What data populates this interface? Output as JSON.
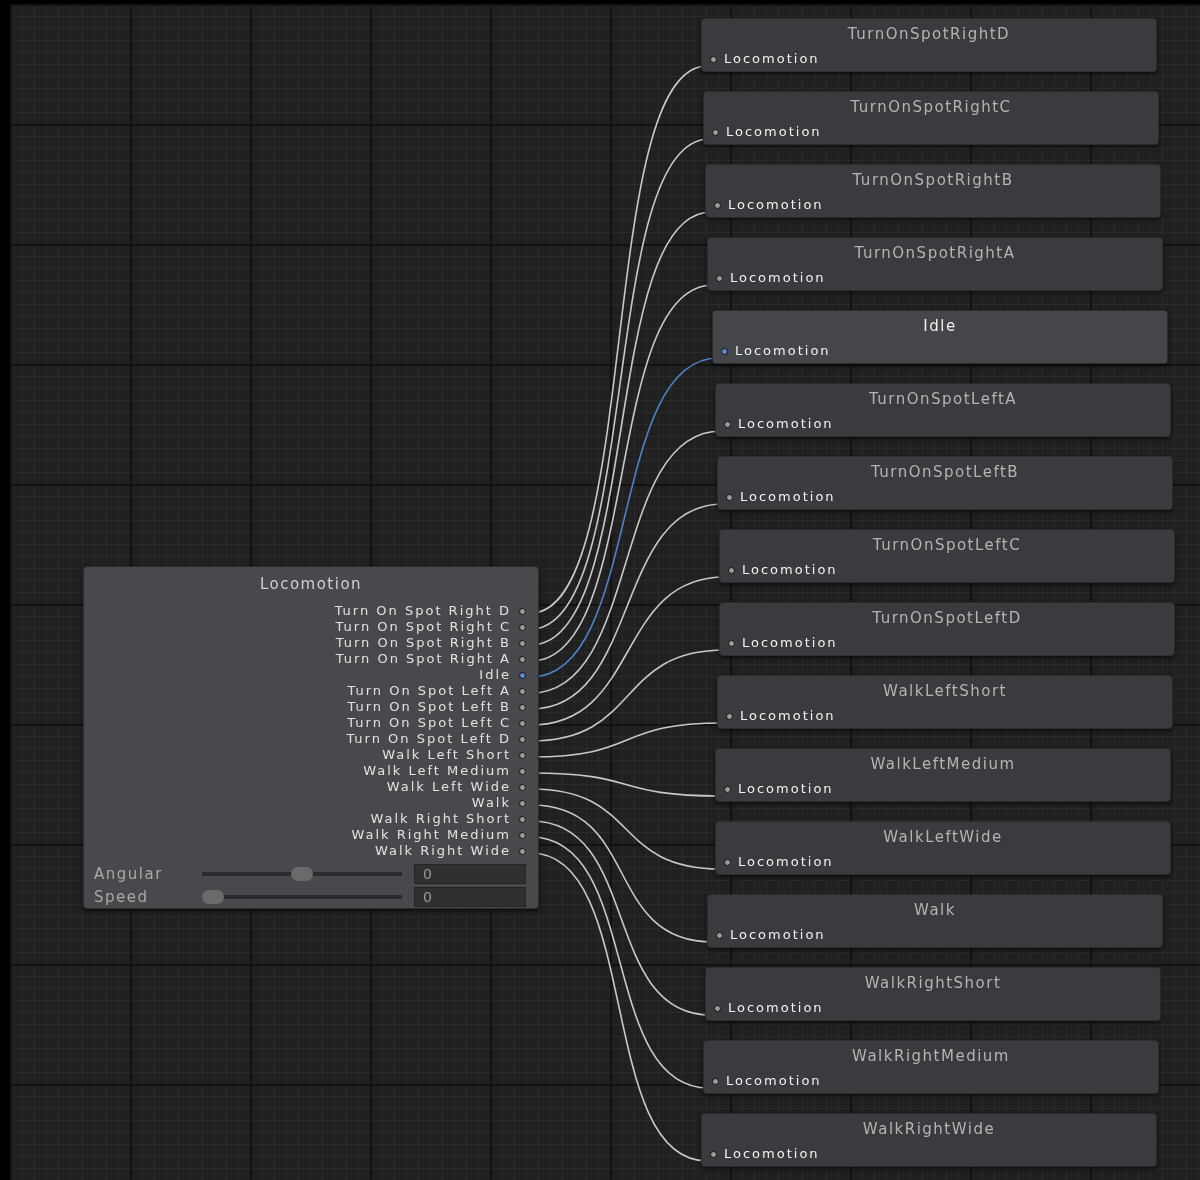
{
  "source": {
    "title": "Locomotion",
    "outputs": [
      {
        "label": "Turn On Spot Right D"
      },
      {
        "label": "Turn On Spot Right C"
      },
      {
        "label": "Turn On Spot Right B"
      },
      {
        "label": "Turn On Spot Right A"
      },
      {
        "label": "Idle"
      },
      {
        "label": "Turn On Spot Left A"
      },
      {
        "label": "Turn On Spot Left B"
      },
      {
        "label": "Turn On Spot Left C"
      },
      {
        "label": "Turn On Spot Left D"
      },
      {
        "label": "Walk Left Short"
      },
      {
        "label": "Walk Left Medium"
      },
      {
        "label": "Walk Left Wide"
      },
      {
        "label": "Walk"
      },
      {
        "label": "Walk Right Short"
      },
      {
        "label": "Walk Right Medium"
      },
      {
        "label": "Walk Right Wide"
      }
    ],
    "parameters": [
      {
        "label": "Angular",
        "level": 0.5,
        "value": "0"
      },
      {
        "label": "Speed",
        "level": 0,
        "value": "0"
      }
    ]
  },
  "targets": [
    {
      "title": "TurnOnSpotRightD",
      "input": "Locomotion",
      "selected": false
    },
    {
      "title": "TurnOnSpotRightC",
      "input": "Locomotion",
      "selected": false
    },
    {
      "title": "TurnOnSpotRightB",
      "input": "Locomotion",
      "selected": false
    },
    {
      "title": "TurnOnSpotRightA",
      "input": "Locomotion",
      "selected": false
    },
    {
      "title": "Idle",
      "input": "Locomotion",
      "selected": true
    },
    {
      "title": "TurnOnSpotLeftA",
      "input": "Locomotion",
      "selected": false
    },
    {
      "title": "TurnOnSpotLeftB",
      "input": "Locomotion",
      "selected": false
    },
    {
      "title": "TurnOnSpotLeftC",
      "input": "Locomotion",
      "selected": false
    },
    {
      "title": "TurnOnSpotLeftD",
      "input": "Locomotion",
      "selected": false
    },
    {
      "title": "WalkLeftShort",
      "input": "Locomotion",
      "selected": false
    },
    {
      "title": "WalkLeftMedium",
      "input": "Locomotion",
      "selected": false
    },
    {
      "title": "WalkLeftWide",
      "input": "Locomotion",
      "selected": false
    },
    {
      "title": "Walk",
      "input": "Locomotion",
      "selected": false
    },
    {
      "title": "WalkRightShort",
      "input": "Locomotion",
      "selected": false
    },
    {
      "title": "WalkRightMedium",
      "input": "Locomotion",
      "selected": false
    },
    {
      "title": "WalkRightWide",
      "input": "Locomotion",
      "selected": false
    }
  ]
}
